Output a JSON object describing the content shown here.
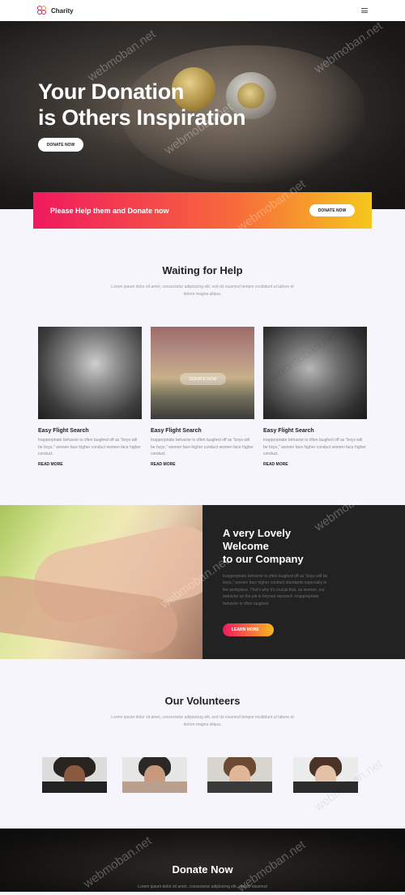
{
  "header": {
    "brand_name": "Charity",
    "colors": {
      "logo_red": "#f0195f",
      "logo_orange": "#f79b1f",
      "logo_purple": "#7b3fa0"
    }
  },
  "hero": {
    "title_line1": "Your Donation",
    "title_line2": "is Others Inspiration",
    "button_label": "DONATE NOW"
  },
  "cta_banner": {
    "text": "Please Help them and Donate now",
    "button_label": "DONATE NOW",
    "gradient": [
      "#f0195f",
      "#f76b3b",
      "#f6c71d"
    ]
  },
  "waiting": {
    "title": "Waiting for Help",
    "subtitle": "Lorem ipsum dolor sit amet, consectetur adipisicing elit, sed do eiusmod tempor incididunt ut labore et dolore magna aliqua.",
    "image_button_label": "DONATE NOW",
    "cards": [
      {
        "title": "Easy Flight Search",
        "text": "Inappropriate behavior is often laughed off as \"boys will be boys,\" women face higher conduct women face higher conduct.",
        "link": "READ MORE"
      },
      {
        "title": "Easy Flight Search",
        "text": "Inappropriate behavior is often laughed off as \"boys will be boys,\" women face higher conduct women face higher conduct.",
        "link": "READ MORE"
      },
      {
        "title": "Easy Flight Search",
        "text": "Inappropriate behavior is often laughed off as \"boys will be boys,\" women face higher conduct women face higher conduct.",
        "link": "READ MORE"
      }
    ]
  },
  "welcome": {
    "title_line1": "A very Lovely",
    "title_line2": "Welcome",
    "title_line3": "to our Company",
    "text": "Inappropriate behavior is often laughed off as \"boys will be boys,\" women face higher conduct standards especially in the workplace. That's why it's crucial that, as women, our behavior on the job is beyond reproach. inappropriate behavior is often laughed.",
    "button_label": "LEARN MORE",
    "button_arrow": "→"
  },
  "volunteers": {
    "title": "Our Volunteers",
    "subtitle": "Lorem ipsum dolor sit amet, consectetur adipisicing elit, sed do eiusmod tempor incididunt ut labore et dolore magna aliqua."
  },
  "donate_section": {
    "title": "Donate Now",
    "subtitle": "Lorem ipsum dolor sit amet, consectetur adipisicing elit, sed do eiusmod"
  },
  "watermark": "webmoban.net"
}
